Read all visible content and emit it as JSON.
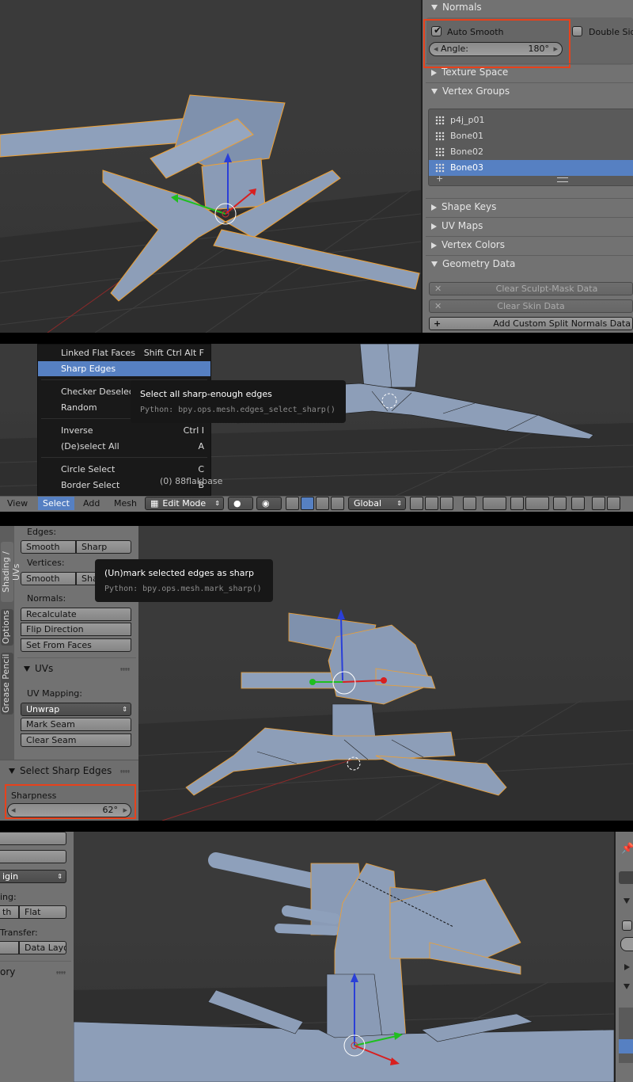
{
  "panel1": {
    "normals_header": "Normals",
    "auto_smooth_label": "Auto Smooth",
    "auto_smooth_checked": true,
    "double_sided_label": "Double Side",
    "angle_label": "Angle:",
    "angle_value": "180°",
    "texture_space": "Texture Space",
    "vertex_groups_header": "Vertex Groups",
    "vertex_groups": [
      "p4j_p01",
      "Bone01",
      "Bone02",
      "Bone03"
    ],
    "selected_group": "Bone03",
    "shape_keys": "Shape Keys",
    "uv_maps": "UV Maps",
    "vertex_colors": "Vertex Colors",
    "geometry_data": "Geometry Data",
    "clear_sculpt": "Clear Sculpt-Mask Data",
    "clear_skin": "Clear Skin Data",
    "add_custom_split": "Add Custom Split Normals Data"
  },
  "panel2": {
    "menu_items": [
      {
        "label": "Linked Flat Faces",
        "shortcut": "Shift Ctrl Alt F"
      },
      {
        "label": "Sharp Edges",
        "shortcut": ""
      },
      {
        "label": "Checker Deselect",
        "shortcut": ""
      },
      {
        "label": "Random",
        "shortcut": ""
      },
      {
        "label": "Inverse",
        "shortcut": "Ctrl I"
      },
      {
        "label": "(De)select All",
        "shortcut": "A"
      },
      {
        "label": "Circle Select",
        "shortcut": "C"
      },
      {
        "label": "Border Select",
        "shortcut": "B"
      }
    ],
    "tooltip_title": "Select all sharp-enough edges",
    "tooltip_python": "Python: bpy.ops.mesh.edges_select_sharp()",
    "object_label": "(0) 88flakbase",
    "header_menus": [
      "View",
      "Select",
      "Add",
      "Mesh"
    ],
    "mode": "Edit Mode",
    "orientation": "Global"
  },
  "panel3": {
    "tabs": [
      "Shading / UVs",
      "Options",
      "Grease Pencil"
    ],
    "edges_label": "Edges:",
    "edges_smooth": "Smooth",
    "edges_sharp": "Sharp",
    "vertices_label": "Vertices:",
    "vertices_smooth": "Smooth",
    "vertices_sharp": "Sharp",
    "normals_label": "Normals:",
    "recalculate": "Recalculate",
    "flip_direction": "Flip Direction",
    "set_from_faces": "Set From Faces",
    "uvs_header": "UVs",
    "uv_mapping_label": "UV Mapping:",
    "unwrap": "Unwrap",
    "mark_seam": "Mark Seam",
    "clear_seam": "Clear Seam",
    "operator_header": "Select Sharp Edges",
    "sharpness_label": "Sharpness",
    "sharpness_value": "62°",
    "tooltip_title": "(Un)mark selected edges as sharp",
    "tooltip_python": "Python: bpy.ops.mesh.mark_sharp()"
  },
  "panel4": {
    "origin_label": "igin",
    "shading_label": "ing:",
    "smooth_partial": "th",
    "flat": "Flat",
    "transfer_label": "Transfer:",
    "data_layout": "Data Layo",
    "history_label": "ory"
  },
  "colors": {
    "highlight": "#e8411b",
    "selection_blue": "#5680c2",
    "mesh": "#8e9cb6"
  }
}
